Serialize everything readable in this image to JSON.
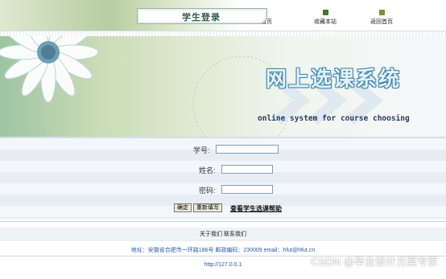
{
  "nav": [
    {
      "label": "设为首页",
      "icon": "home-icon",
      "color": "#2a8a3a"
    },
    {
      "label": "收藏本站",
      "icon": "bookmark-icon",
      "color": "#3a7a2a"
    },
    {
      "label": "返回首页",
      "icon": "back-icon",
      "color": "#8a8a2a"
    }
  ],
  "hero": {
    "login_title": "学生登录",
    "big_title": "网上选课系统",
    "subtitle": "online system for course choosing"
  },
  "form": {
    "student_id_label": "学号:",
    "name_label": "姓名:",
    "password_label": "密码:",
    "confirm_button": "确定",
    "reset_button": "重新填写",
    "help_link": "查看学生选课帮助"
  },
  "footer": {
    "about": "关于我们 联系我们",
    "address": "地址：安徽省合肥市一环路186号 邮政编码：230009 email：hfut@hfut.cn",
    "url": "http://127.0.0.1"
  },
  "watermark": "CSDN @毕业设计方案专家"
}
